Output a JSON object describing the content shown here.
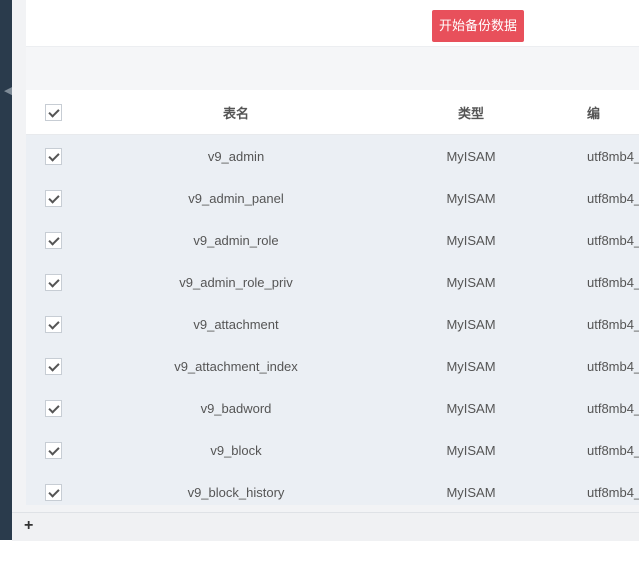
{
  "toolbar": {
    "backup_button": "开始备份数据"
  },
  "table": {
    "columns": {
      "name": "表名",
      "type": "类型",
      "encoding": "编"
    },
    "header_checked": true,
    "rows": [
      {
        "name": "v9_admin",
        "type": "MyISAM",
        "encoding": "utf8mb4_",
        "checked": true
      },
      {
        "name": "v9_admin_panel",
        "type": "MyISAM",
        "encoding": "utf8mb4_",
        "checked": true
      },
      {
        "name": "v9_admin_role",
        "type": "MyISAM",
        "encoding": "utf8mb4_",
        "checked": true
      },
      {
        "name": "v9_admin_role_priv",
        "type": "MyISAM",
        "encoding": "utf8mb4_",
        "checked": true
      },
      {
        "name": "v9_attachment",
        "type": "MyISAM",
        "encoding": "utf8mb4_",
        "checked": true
      },
      {
        "name": "v9_attachment_index",
        "type": "MyISAM",
        "encoding": "utf8mb4_",
        "checked": true
      },
      {
        "name": "v9_badword",
        "type": "MyISAM",
        "encoding": "utf8mb4_",
        "checked": true
      },
      {
        "name": "v9_block",
        "type": "MyISAM",
        "encoding": "utf8mb4_",
        "checked": true
      },
      {
        "name": "v9_block_history",
        "type": "MyISAM",
        "encoding": "utf8mb4_",
        "checked": true
      }
    ]
  },
  "footer": {
    "expand_symbol": "+"
  },
  "sidebar": {
    "collapse_symbol": "◀"
  },
  "colors": {
    "accent": "#e8505b",
    "nav": "#2a3b4c",
    "row_bg": "#ebeff4"
  }
}
